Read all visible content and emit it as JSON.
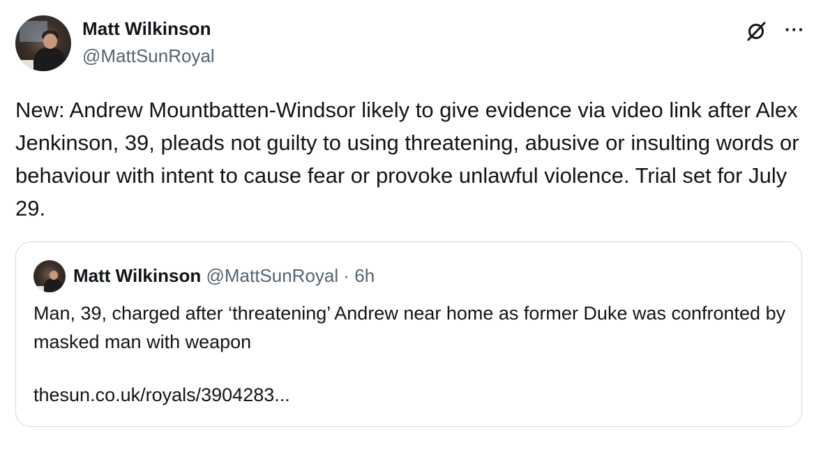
{
  "author": {
    "display_name": "Matt Wilkinson",
    "handle": "@MattSunRoyal"
  },
  "icons": {
    "grok": "grok-icon",
    "more": "more-options-icon"
  },
  "more_label": "···",
  "tweet": {
    "text": "New: Andrew Mountbatten-Windsor likely to give evidence via video link after Alex Jenkinson, 39, pleads not guilty to using threatening, abusive or insulting words or behaviour with intent to cause fear or provoke unlawful violence. Trial set for July 29."
  },
  "quoted_tweet": {
    "display_name": "Matt Wilkinson",
    "handle": "@MattSunRoyal",
    "separator": "·",
    "time": "6h",
    "text": "Man, 39, charged after ‘threatening’ Andrew near home as former Duke was confronted by masked man with weapon",
    "link": "thesun.co.uk/royals/3904283..."
  },
  "colors": {
    "text": "#0f1419",
    "secondary": "#536471",
    "border": "#cfd9de"
  }
}
